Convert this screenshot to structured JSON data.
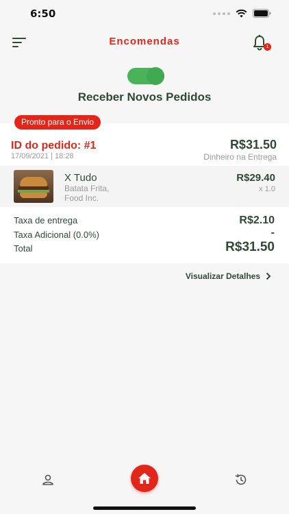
{
  "status_bar": {
    "time": "6:50"
  },
  "header": {
    "title": "Encomendas",
    "notification_count": "1"
  },
  "receive_orders": {
    "label": "Receber Novos Pedidos",
    "enabled": true
  },
  "order": {
    "status": "Pronto para o Envio",
    "id_label": "ID do pedido: #1",
    "date": "17/09/2021 | 18:28",
    "total": "R$31.50",
    "payment_method": "Dinheiro na Entrega",
    "items": [
      {
        "name": "X Tudo",
        "description": "Batata Frita, Food Inc.",
        "price": "R$29.40",
        "quantity": "x 1.0"
      }
    ],
    "summary": {
      "delivery_fee_label": "Taxa de entrega",
      "delivery_fee": "R$2.10",
      "extra_fee_label": "Taxa Adicional (0.0%)",
      "extra_fee": "-",
      "total_label": "Total",
      "total": "R$31.50"
    },
    "details_link": "Visualizar Detalhes"
  },
  "bottom_nav": {
    "items": [
      "profile-icon",
      "home-icon",
      "history-icon"
    ]
  },
  "colors": {
    "accent": "#e3261a",
    "text": "#2e4a34",
    "toggle": "#49b35a",
    "muted": "#9a9a9a"
  }
}
